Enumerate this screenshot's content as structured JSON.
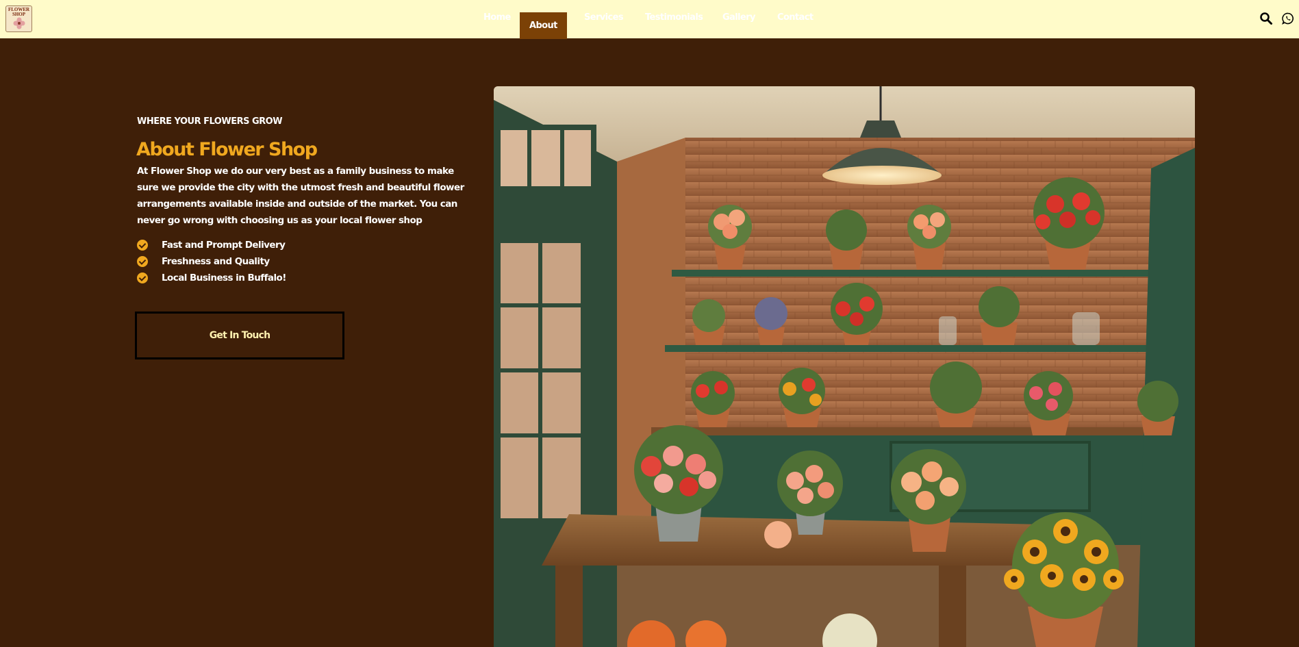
{
  "header": {
    "logo": {
      "text_line1": "FLOWER",
      "text_line2": "SHOP"
    },
    "nav": [
      {
        "label": "Home",
        "active": false
      },
      {
        "label": "About",
        "active": true
      },
      {
        "label": "Services",
        "active": false
      },
      {
        "label": "Testimonials",
        "active": false
      },
      {
        "label": "Gallery",
        "active": false
      },
      {
        "label": "Contact",
        "active": false
      }
    ],
    "icons": [
      "search-icon",
      "whatsapp-icon"
    ]
  },
  "about": {
    "eyebrow": "WHERE YOUR FLOWERS GROW",
    "title": "About Flower Shop",
    "description": "At Flower Shop we do our very best as a family business to make sure we provide the city with the utmost fresh and beautiful flower arrangements available inside and outside of the market. You can never go wrong with choosing us as your local flower shop",
    "features": [
      "Fast and Prompt Delivery",
      "Freshness and Quality",
      "Local Business in Buffalo!"
    ],
    "cta_label": "Get In Touch"
  },
  "colors": {
    "background": "#3f1f08",
    "header_bg": "#fffbc9",
    "accent": "#f0a81f",
    "nav_active_bg": "#7b4106"
  }
}
